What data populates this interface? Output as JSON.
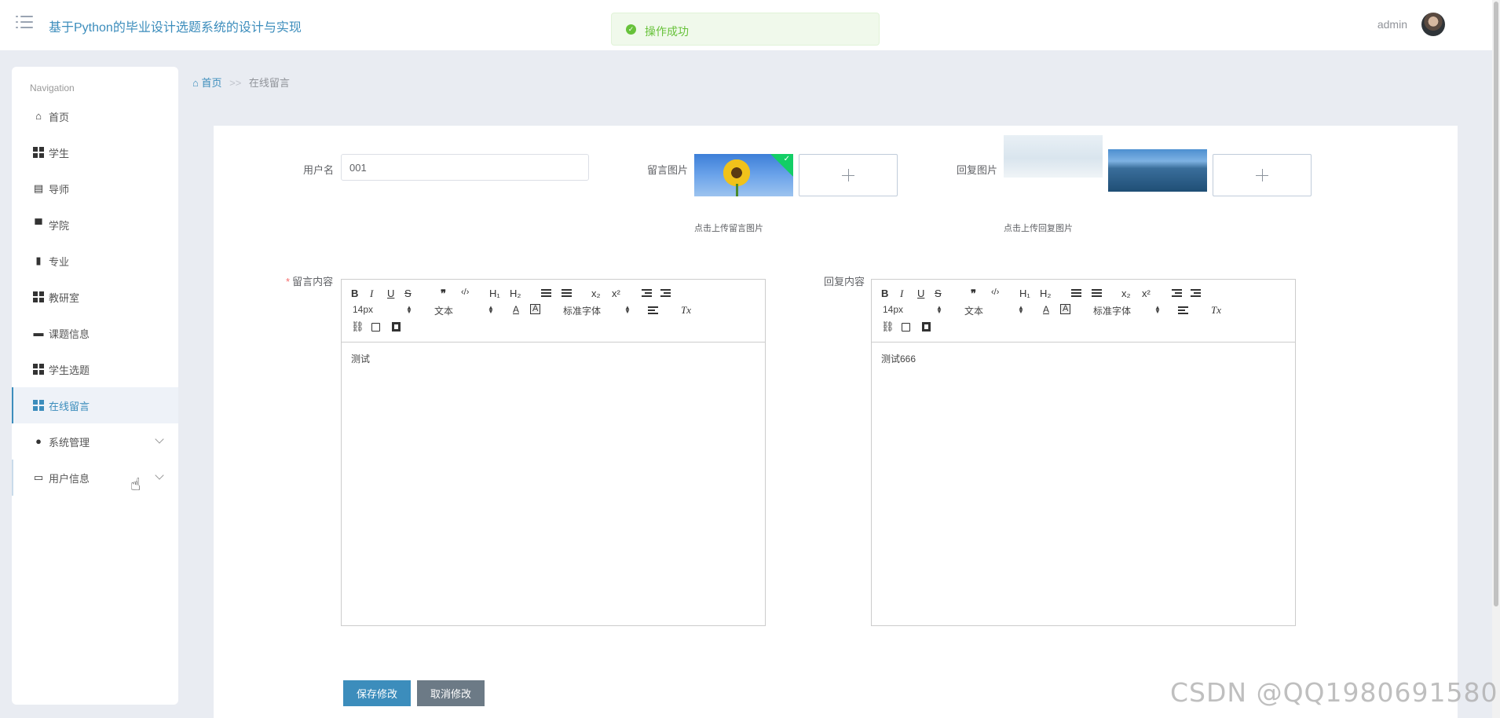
{
  "header": {
    "app_title": "基于Python的毕业设计选题系统的设计与实现",
    "user_name": "admin",
    "toast": "操作成功"
  },
  "sidebar": {
    "heading": "Navigation",
    "items": [
      {
        "label": "首页",
        "icon": "home-icon"
      },
      {
        "label": "学生",
        "icon": "grid-icon"
      },
      {
        "label": "导师",
        "icon": "clipboard-icon"
      },
      {
        "label": "学院",
        "icon": "flag-icon"
      },
      {
        "label": "专业",
        "icon": "bar-chart-icon"
      },
      {
        "label": "教研室",
        "icon": "grid-icon"
      },
      {
        "label": "课题信息",
        "icon": "briefcase-icon"
      },
      {
        "label": "学生选题",
        "icon": "grid-icon"
      },
      {
        "label": "在线留言",
        "icon": "grid-icon",
        "active": true
      },
      {
        "label": "系统管理",
        "icon": "user-icon"
      },
      {
        "label": "用户信息",
        "icon": "card-icon"
      }
    ]
  },
  "breadcrumb": {
    "home": "首页",
    "separator": ">>",
    "current": "在线留言"
  },
  "form": {
    "username_label": "用户名",
    "username_value": "001",
    "message_image_label": "留言图片",
    "message_image_tip": "点击上传留言图片",
    "reply_image_label": "回复图片",
    "reply_image_tip": "点击上传回复图片",
    "message_content_label": "留言内容",
    "reply_content_label": "回复内容",
    "message_content": "测试",
    "reply_content": "测试666"
  },
  "editor_toolbar": {
    "bold": "B",
    "italic": "I",
    "underline": "U",
    "strike": "S",
    "quote": "❞",
    "code": "‹/›",
    "h1": "H₁",
    "h2": "H₂",
    "subscript": "x₂",
    "superscript": "x²",
    "font_size": "14px",
    "header_select": "文本",
    "font_family": "标准字体",
    "text_color": "A",
    "clean": "Tx"
  },
  "buttons": {
    "save": "保存修改",
    "cancel": "取消修改"
  },
  "watermark": "CSDN @QQ1980691580",
  "colors": {
    "accent": "#3c8dbc",
    "success": "#67c23a"
  }
}
